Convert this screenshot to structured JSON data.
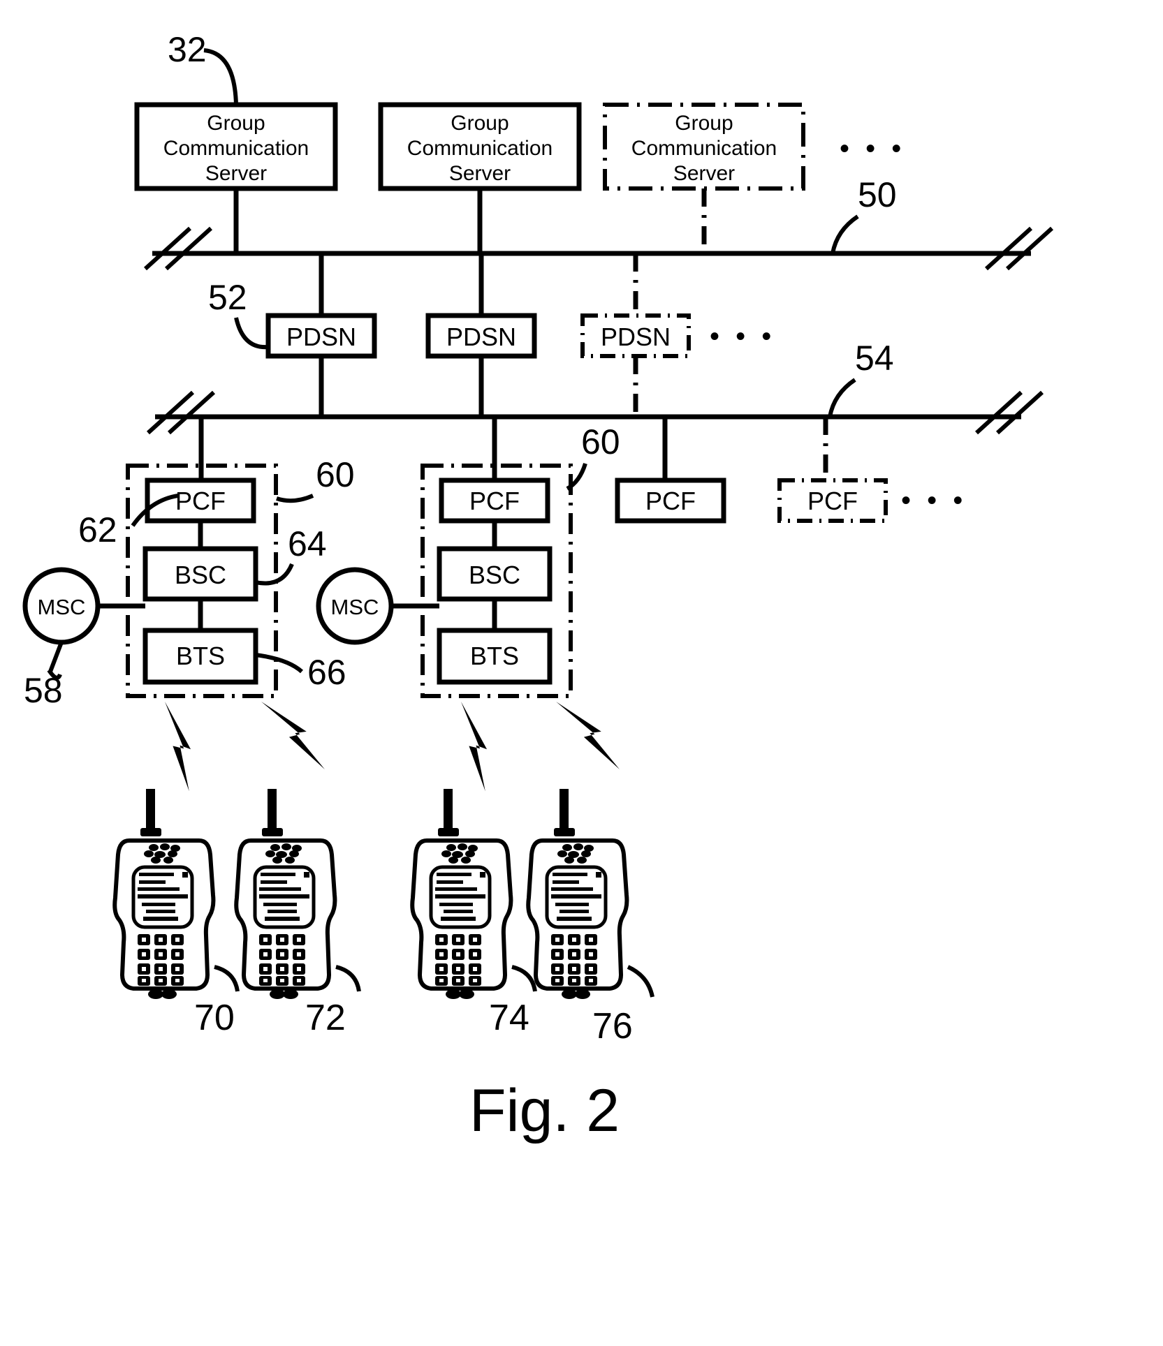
{
  "figure": {
    "caption": "Fig. 2",
    "title": "Group communication system network architecture diagram"
  },
  "blocks": {
    "server1": {
      "line1": "Group",
      "line2": "Communication",
      "line3": "Server",
      "style": "solid"
    },
    "server2": {
      "line1": "Group",
      "line2": "Communication",
      "line3": "Server",
      "style": "solid"
    },
    "server3": {
      "line1": "Group",
      "line2": "Communication",
      "line3": "Server",
      "style": "dash-dot"
    },
    "pdsn1": {
      "label": "PDSN",
      "style": "solid"
    },
    "pdsn2": {
      "label": "PDSN",
      "style": "solid"
    },
    "pdsn3": {
      "label": "PDSN",
      "style": "dash-dot"
    },
    "pcf1": {
      "label": "PCF",
      "style": "solid"
    },
    "pcf2": {
      "label": "PCF",
      "style": "solid"
    },
    "pcf3": {
      "label": "PCF",
      "style": "solid"
    },
    "pcf4": {
      "label": "PCF",
      "style": "dash-dot"
    },
    "bsc1": {
      "label": "BSC",
      "style": "solid"
    },
    "bsc2": {
      "label": "BSC",
      "style": "solid"
    },
    "bts1": {
      "label": "BTS",
      "style": "solid"
    },
    "bts2": {
      "label": "BTS",
      "style": "solid"
    },
    "msc1": {
      "label": "MSC",
      "style": "circle"
    },
    "msc2": {
      "label": "MSC",
      "style": "circle"
    }
  },
  "ellipses": {
    "servers_row": "• • •",
    "pdsn_row": "• • •",
    "pcf_row": "• • •"
  },
  "reference_numerals": {
    "n32": "32",
    "n50": "50",
    "n52": "52",
    "n54": "54",
    "n58": "58",
    "n60a": "60",
    "n60b": "60",
    "n62": "62",
    "n64": "64",
    "n66": "66",
    "n70": "70",
    "n72": "72",
    "n74": "74",
    "n76": "76"
  },
  "handsets": [
    {
      "id": "70",
      "numeral": "70"
    },
    {
      "id": "72",
      "numeral": "72"
    },
    {
      "id": "74",
      "numeral": "74"
    },
    {
      "id": "76",
      "numeral": "76"
    }
  ],
  "colors": {
    "ink": "#000000",
    "paper": "#ffffff"
  }
}
